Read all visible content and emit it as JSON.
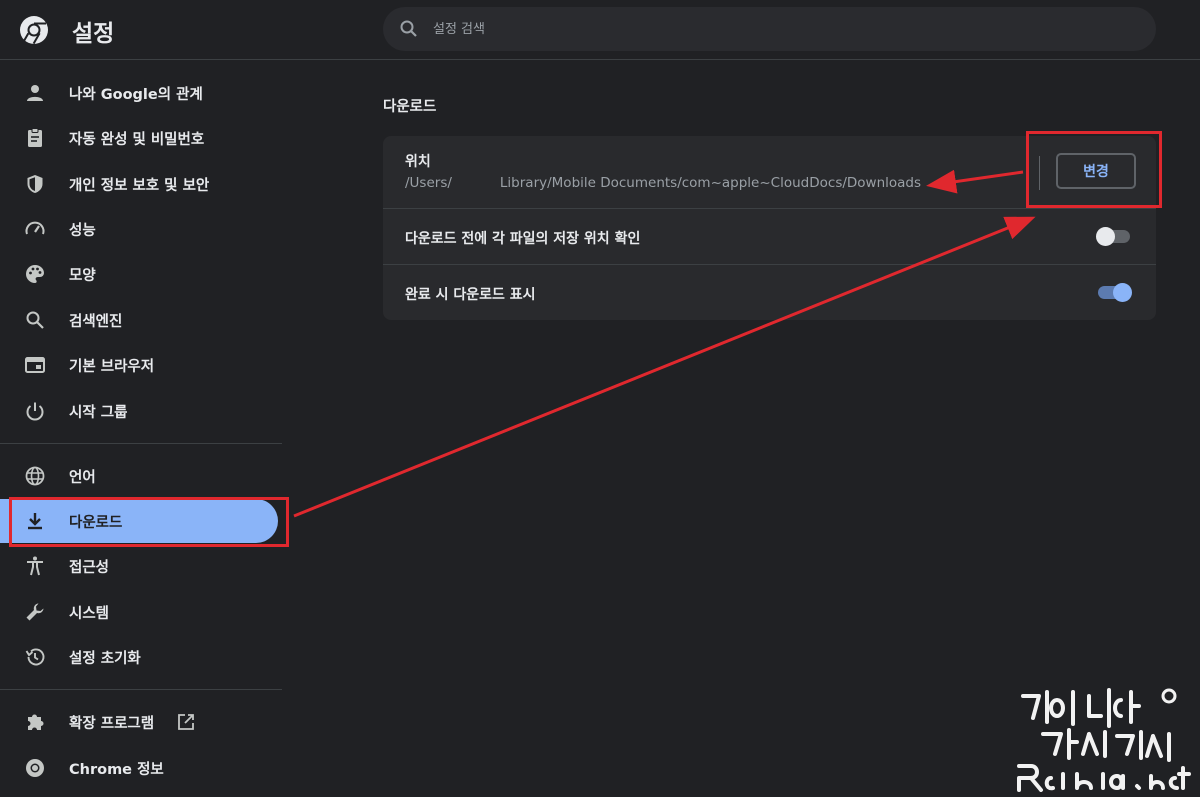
{
  "header": {
    "title": "설정",
    "search_placeholder": "설정 검색"
  },
  "sidebar": {
    "items": [
      {
        "label": "나와 Google의 관계",
        "icon": "person-icon"
      },
      {
        "label": "자동 완성 및 비밀번호",
        "icon": "clipboard-icon"
      },
      {
        "label": "개인 정보 보호 및 보안",
        "icon": "shield-icon"
      },
      {
        "label": "성능",
        "icon": "gauge-icon"
      },
      {
        "label": "모양",
        "icon": "palette-icon"
      },
      {
        "label": "검색엔진",
        "icon": "search-icon"
      },
      {
        "label": "기본 브라우저",
        "icon": "browser-icon"
      },
      {
        "label": "시작 그룹",
        "icon": "power-icon"
      },
      {
        "label": "언어",
        "icon": "globe-icon"
      },
      {
        "label": "다운로드",
        "icon": "download-icon",
        "active": true
      },
      {
        "label": "접근성",
        "icon": "accessibility-icon"
      },
      {
        "label": "시스템",
        "icon": "wrench-icon"
      },
      {
        "label": "설정 초기화",
        "icon": "history-icon"
      },
      {
        "label": "확장 프로그램",
        "icon": "puzzle-icon"
      },
      {
        "label": "Chrome 정보",
        "icon": "chrome-icon"
      }
    ]
  },
  "main": {
    "section_title": "다운로드",
    "location": {
      "label": "위치",
      "path_start": "/Users/",
      "path_end": "Library/Mobile Documents/com~apple~CloudDocs/Downloads",
      "button_label": "변경"
    },
    "ask_before": {
      "label": "다운로드 전에 각 파일의 저장 위치 확인",
      "enabled": false
    },
    "show_when_done": {
      "label": "완료 시 다운로드 표시",
      "enabled": true
    }
  },
  "colors": {
    "background": "#202124",
    "accent": "#8ab4f8",
    "annotation": "#e0282e"
  }
}
